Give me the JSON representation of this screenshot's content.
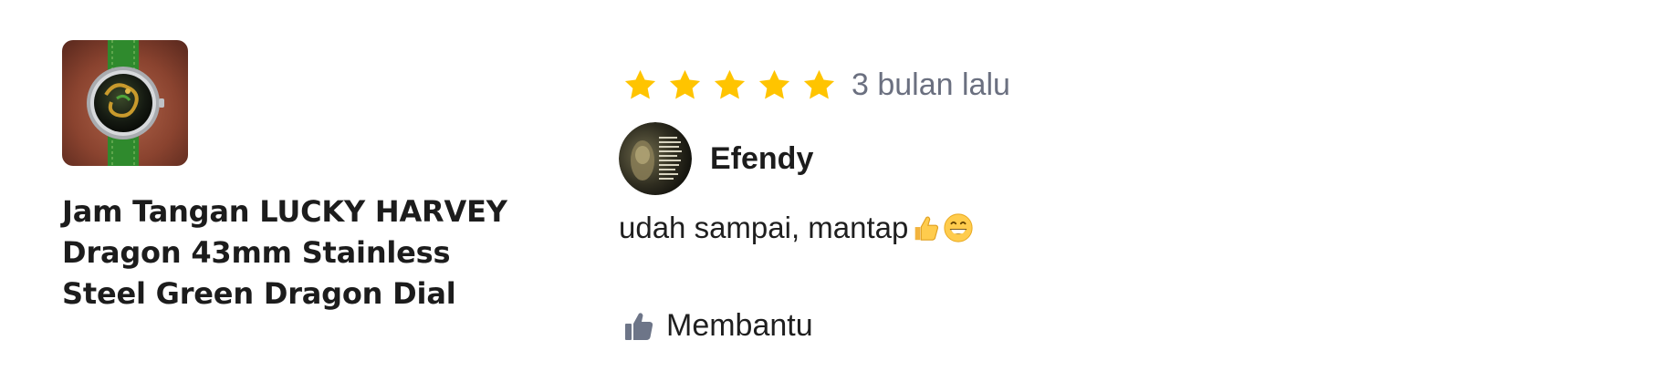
{
  "product": {
    "title": "Jam Tangan LUCKY HARVEY Dragon 43mm Stainless Steel Green Dragon Dial"
  },
  "review": {
    "rating": 5,
    "max_rating": 5,
    "time_ago": "3 bulan lalu",
    "reviewer_name": "Efendy",
    "text": "udah sampai, mantap",
    "helpful_label": "Membantu"
  },
  "colors": {
    "star": "#ffc400",
    "muted_text": "#6b7080",
    "thumb_icon": "#6d7588"
  }
}
